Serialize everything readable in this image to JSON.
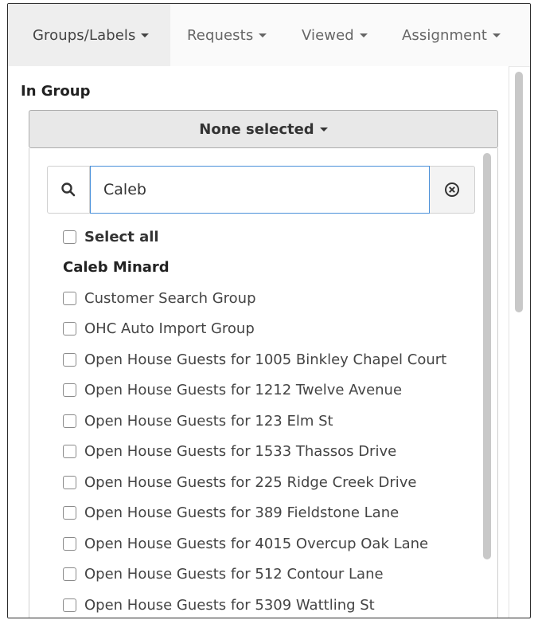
{
  "nav": {
    "items": [
      {
        "label": "Groups/Labels",
        "active": true
      },
      {
        "label": "Requests",
        "active": false
      },
      {
        "label": "Viewed",
        "active": false
      },
      {
        "label": "Assignment",
        "active": false
      }
    ]
  },
  "panel": {
    "heading": "In Group",
    "select_label": "None selected",
    "search": {
      "value": "Caleb",
      "icon": "search-icon",
      "clear_icon": "clear-circle-icon"
    },
    "select_all": "Select all",
    "group_label": "Caleb Minard",
    "options": [
      "Customer Search Group",
      "OHC Auto Import Group",
      "Open House Guests for 1005 Binkley Chapel Court",
      "Open House Guests for 1212 Twelve Avenue",
      "Open House Guests for 123 Elm St",
      "Open House Guests for 1533 Thassos Drive",
      "Open House Guests for 225 Ridge Creek Drive",
      "Open House Guests for 389 Fieldstone Lane",
      "Open House Guests for 4015 Overcup Oak Lane",
      "Open House Guests for 512 Contour Lane",
      "Open House Guests for 5309 Wattling St"
    ]
  },
  "colors": {
    "accent_border": "#4a90d9",
    "green_marker": "#4caf50"
  }
}
